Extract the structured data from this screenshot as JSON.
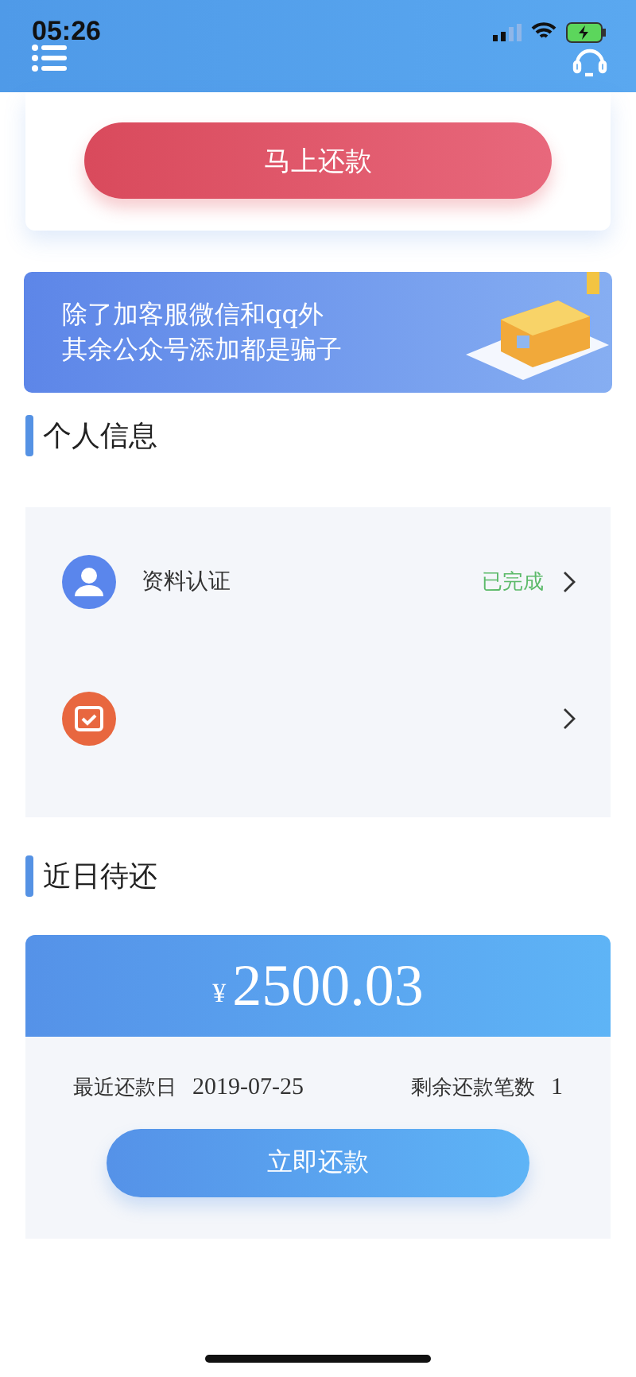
{
  "status_bar": {
    "time": "05:26"
  },
  "top_card": {
    "button": "马上还款"
  },
  "notice_banner": {
    "lines": [
      "除了加客服微信和qq外",
      "其余公众号添加都是骗子"
    ]
  },
  "personal_info": {
    "title": "个人信息",
    "items": [
      {
        "kind": "profile",
        "label": "资料认证",
        "status": "已完成"
      },
      {
        "kind": "calendar"
      }
    ]
  },
  "pending": {
    "title": "近日待还",
    "currency": "¥",
    "amount": "2500.03",
    "due_label": "最近还款日",
    "due_date": "2019-07-25",
    "remaining_label": "剩余还款笔数",
    "remaining_count": "1",
    "button": "立即还款"
  }
}
